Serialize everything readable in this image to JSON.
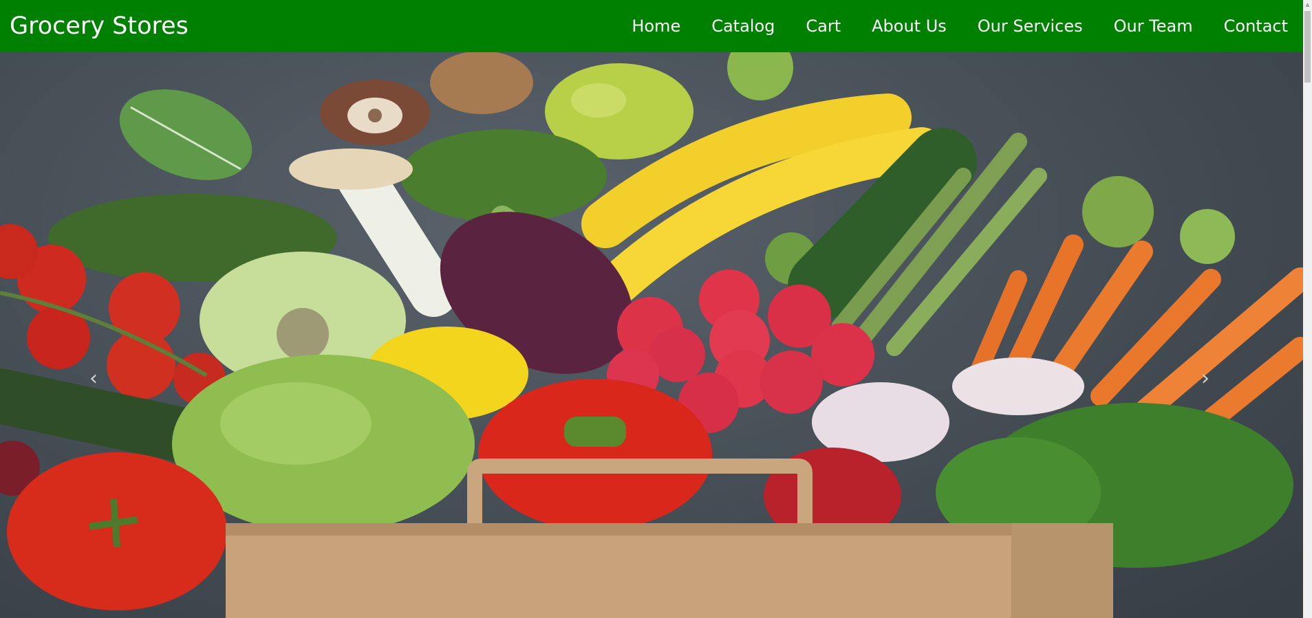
{
  "brand": "Grocery Stores",
  "nav": {
    "items": [
      "Home",
      "Catalog",
      "Cart",
      "About Us",
      "Our Services",
      "Our Team",
      "Contact"
    ]
  },
  "hero": {
    "image": "groceries-in-paper-bag",
    "prev_icon": "‹",
    "next_icon": "›"
  },
  "scrollbar": {
    "up_icon": "▲"
  },
  "colors": {
    "navbar": "#008000",
    "nav_text": "#ffffff"
  }
}
